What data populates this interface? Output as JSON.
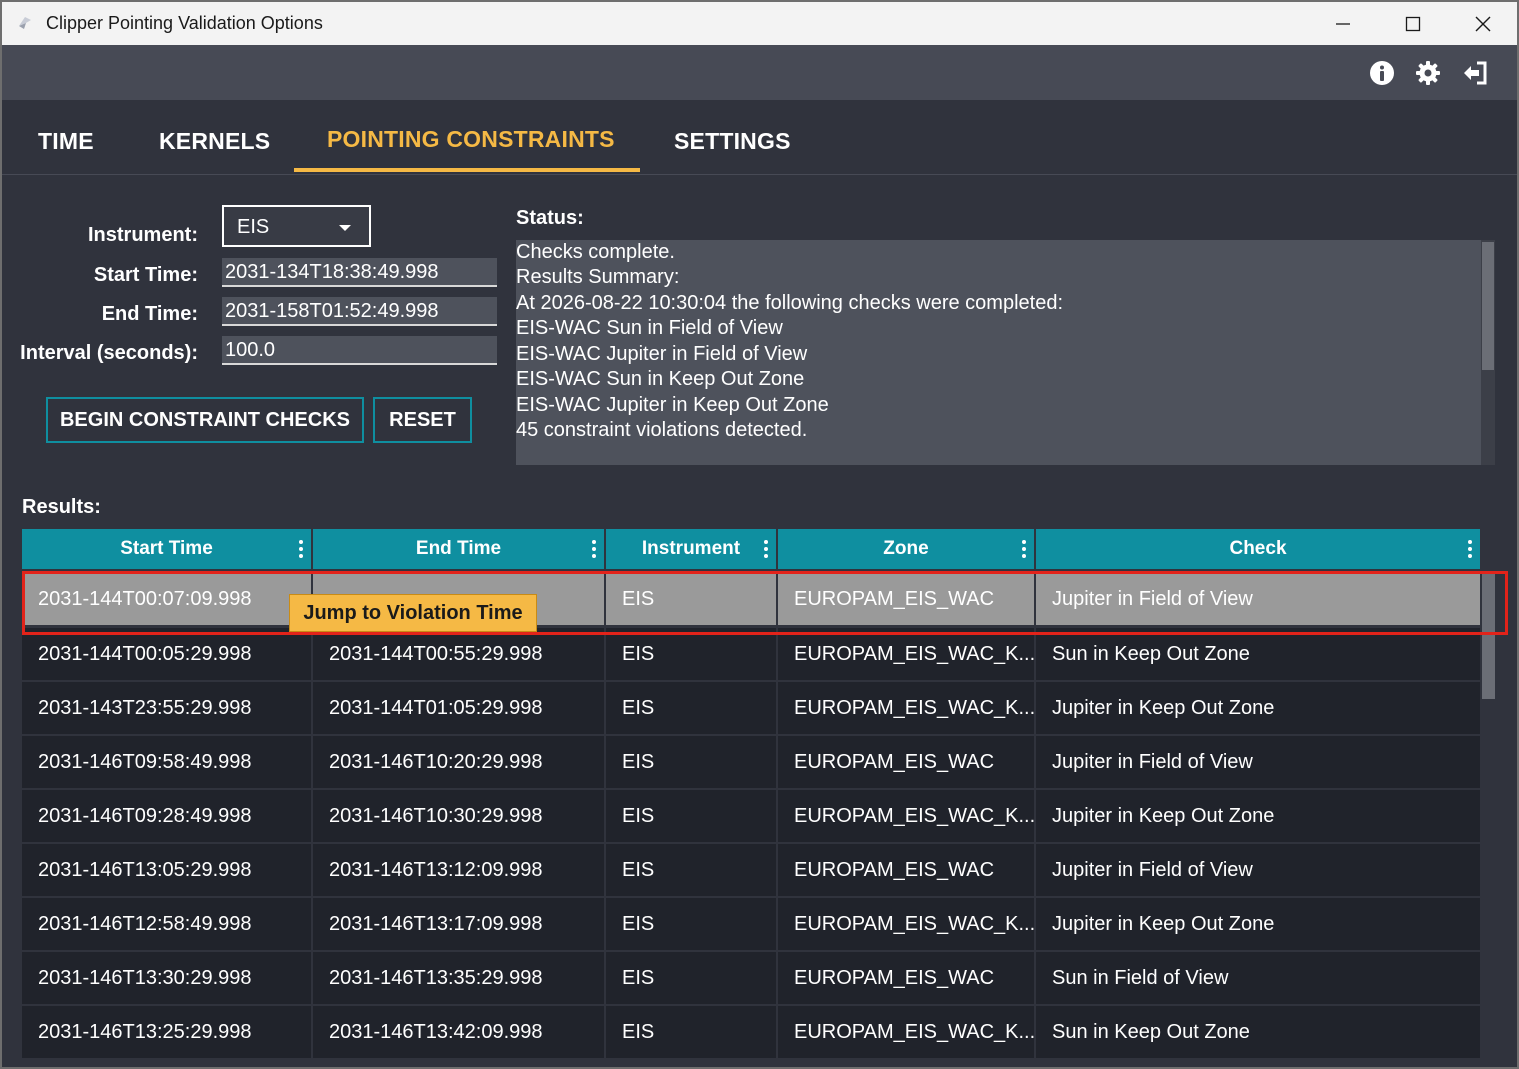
{
  "window": {
    "title": "Clipper Pointing Validation Options",
    "controls": [
      "minimize",
      "maximize",
      "close"
    ]
  },
  "toolbar": {
    "icons": [
      "info-icon",
      "gear-icon",
      "logout-icon"
    ]
  },
  "tabs": [
    {
      "label": "TIME",
      "active": false
    },
    {
      "label": "KERNELS",
      "active": false
    },
    {
      "label": "POINTING CONSTRAINTS",
      "active": true
    },
    {
      "label": "SETTINGS",
      "active": false
    }
  ],
  "form": {
    "instrument_label": "Instrument:",
    "instrument_value": "EIS",
    "start_label": "Start Time:",
    "start_value": "2031-134T18:38:49.998",
    "end_label": "End Time:",
    "end_value": "2031-158T01:52:49.998",
    "interval_label": "Interval (seconds):",
    "interval_value": "100.0",
    "begin_button": "BEGIN CONSTRAINT CHECKS",
    "reset_button": "RESET"
  },
  "status": {
    "label": "Status:",
    "lines": [
      "Checks complete.",
      "Results Summary:",
      "At 2026-08-22 10:30:04 the following checks were completed:",
      "EIS-WAC Sun in Field of View",
      "EIS-WAC Jupiter in Field of View",
      "EIS-WAC Sun in Keep Out Zone",
      "EIS-WAC Jupiter in Keep Out Zone",
      "45 constraint violations detected."
    ]
  },
  "results": {
    "label": "Results:",
    "columns": [
      "Start Time",
      "End Time",
      "Instrument",
      "Zone",
      "Check"
    ],
    "rows": [
      [
        "2031-144T00:07:09.998",
        "",
        "EIS",
        "EUROPAM_EIS_WAC",
        "Jupiter in Field of View"
      ],
      [
        "2031-144T00:05:29.998",
        "2031-144T00:55:29.998",
        "EIS",
        "EUROPAM_EIS_WAC_K...",
        "Sun in Keep Out Zone"
      ],
      [
        "2031-143T23:55:29.998",
        "2031-144T01:05:29.998",
        "EIS",
        "EUROPAM_EIS_WAC_K...",
        "Jupiter in Keep Out Zone"
      ],
      [
        "2031-146T09:58:49.998",
        "2031-146T10:20:29.998",
        "EIS",
        "EUROPAM_EIS_WAC",
        "Jupiter in Field of View"
      ],
      [
        "2031-146T09:28:49.998",
        "2031-146T10:30:29.998",
        "EIS",
        "EUROPAM_EIS_WAC_K...",
        "Jupiter in Keep Out Zone"
      ],
      [
        "2031-146T13:05:29.998",
        "2031-146T13:12:09.998",
        "EIS",
        "EUROPAM_EIS_WAC",
        "Jupiter in Field of View"
      ],
      [
        "2031-146T12:58:49.998",
        "2031-146T13:17:09.998",
        "EIS",
        "EUROPAM_EIS_WAC_K...",
        "Jupiter in Keep Out Zone"
      ],
      [
        "2031-146T13:30:29.998",
        "2031-146T13:35:29.998",
        "EIS",
        "EUROPAM_EIS_WAC",
        "Sun in Field of View"
      ],
      [
        "2031-146T13:25:29.998",
        "2031-146T13:42:09.998",
        "EIS",
        "EUROPAM_EIS_WAC_K...",
        "Sun in Keep Out Zone"
      ]
    ],
    "selected_row": 0,
    "tooltip": "Jump to Violation Time"
  },
  "colors": {
    "accent": "#f5b945",
    "teal": "#0f8fa0",
    "background": "#30333d",
    "highlight": "#e2231a"
  }
}
